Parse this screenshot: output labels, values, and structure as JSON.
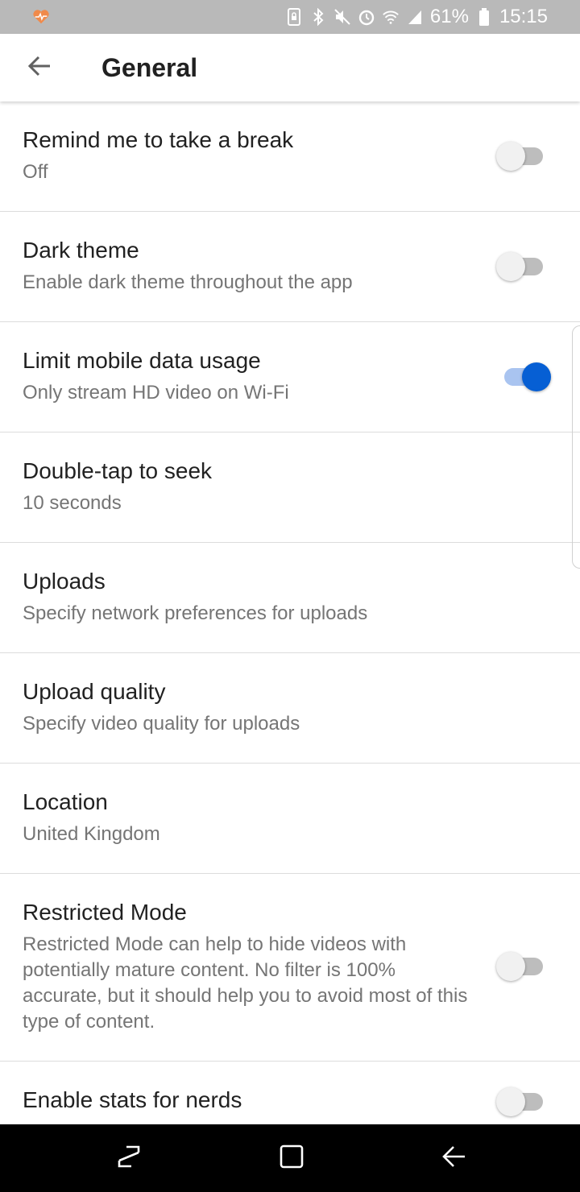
{
  "status_bar": {
    "battery_percent": "61%",
    "time": "15:15",
    "icons": [
      "health-heart-icon",
      "screen-lock-icon",
      "bluetooth-icon",
      "mute-icon",
      "alarm-icon",
      "wifi-icon",
      "signal-icon",
      "battery-icon"
    ]
  },
  "app_bar": {
    "title": "General",
    "back_icon": "arrow-back-icon"
  },
  "settings": [
    {
      "title": "Remind me to take a break",
      "subtitle": "Off",
      "toggle": "off"
    },
    {
      "title": "Dark theme",
      "subtitle": "Enable dark theme throughout the app",
      "toggle": "off"
    },
    {
      "title": "Limit mobile data usage",
      "subtitle": "Only stream HD video on Wi-Fi",
      "toggle": "on"
    },
    {
      "title": "Double-tap to seek",
      "subtitle": "10 seconds",
      "toggle": "none"
    },
    {
      "title": "Uploads",
      "subtitle": "Specify network preferences for uploads",
      "toggle": "none"
    },
    {
      "title": "Upload quality",
      "subtitle": "Specify video quality for uploads",
      "toggle": "none"
    },
    {
      "title": "Location",
      "subtitle": "United Kingdom",
      "toggle": "none"
    },
    {
      "title": "Restricted Mode",
      "subtitle": "Restricted Mode can help to hide videos with potentially mature content. No filter is 100% accurate, but it should help you to avoid most of this type of content.",
      "toggle": "off"
    },
    {
      "title": "Enable stats for nerds",
      "subtitle": "",
      "toggle": "off"
    }
  ],
  "nav_bar": {
    "buttons": [
      "recents-icon",
      "home-icon",
      "back-icon"
    ]
  },
  "colors": {
    "status_bar": "#b9b9b9",
    "accent": "#065fd4",
    "accent_track": "#a9c4f0",
    "divider": "#dcdcdc",
    "secondary_text": "#757575"
  }
}
